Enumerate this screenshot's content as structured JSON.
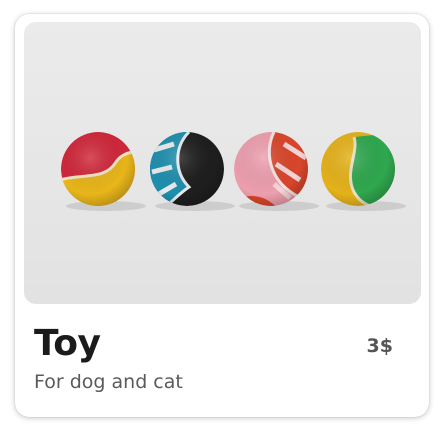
{
  "card": {
    "title": "Toy",
    "price": "3$",
    "subtitle": "For dog and cat",
    "image_icon": "tennis-balls-photo"
  }
}
